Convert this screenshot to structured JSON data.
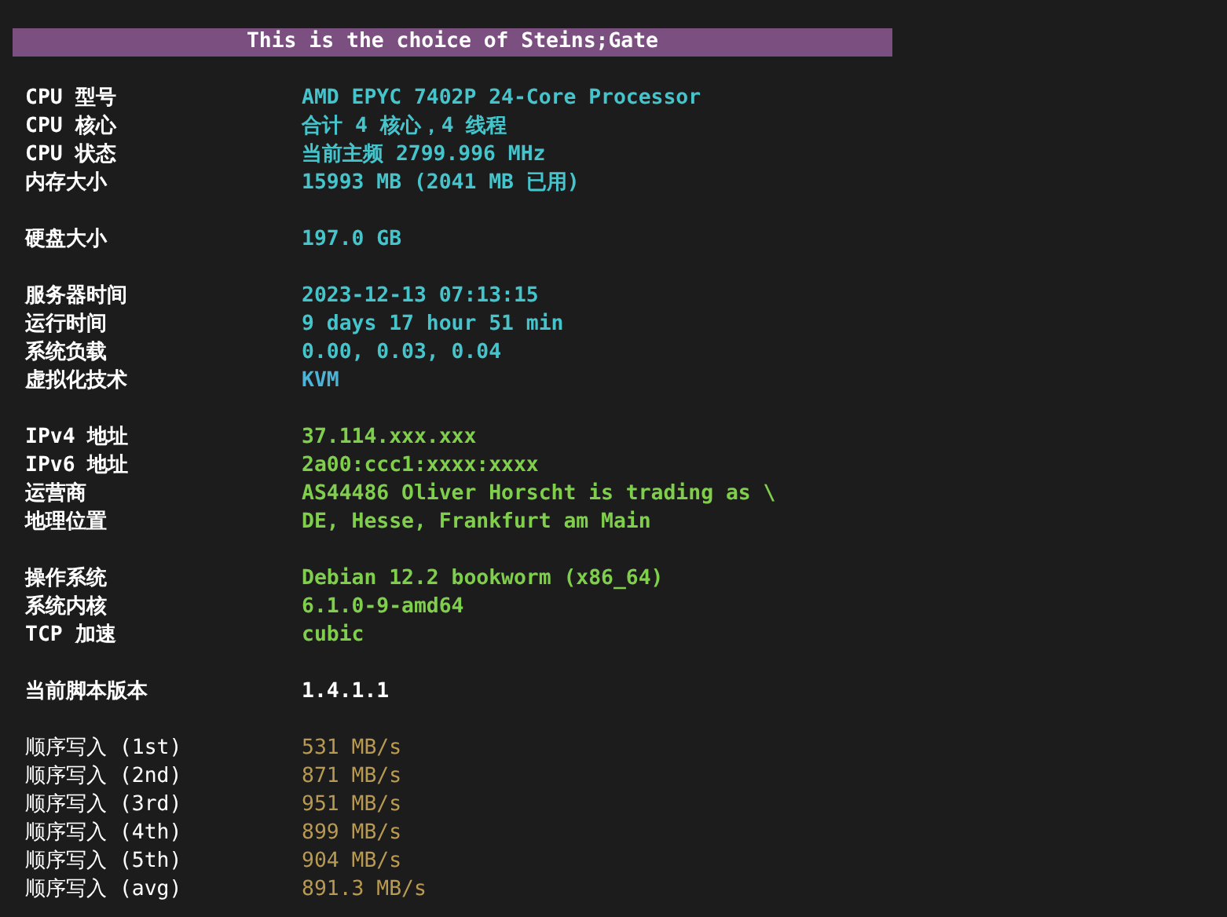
{
  "banner": "This is the choice of Steins;Gate",
  "sections": [
    {
      "kind": "info",
      "rows": [
        {
          "label": "CPU 型号",
          "value": "AMD EPYC 7402P 24-Core Processor",
          "color": "#45c4cc"
        },
        {
          "label": "CPU 核心",
          "value": "合计 4 核心，4 线程",
          "color": "#45c4cc"
        },
        {
          "label": "CPU 状态",
          "value": "当前主频 2799.996 MHz",
          "color": "#45c4cc"
        },
        {
          "label": "内存大小",
          "value": "15993 MB (2041 MB 已用)",
          "color": "#45c4cc"
        }
      ]
    },
    {
      "kind": "info",
      "rows": [
        {
          "label": "硬盘大小",
          "value": "197.0 GB",
          "color": "#45c4cc"
        }
      ]
    },
    {
      "kind": "info",
      "rows": [
        {
          "label": "服务器时间",
          "value": "2023-12-13 07:13:15",
          "color": "#45c4cc"
        },
        {
          "label": "运行时间",
          "value": "9 days 17 hour 51 min",
          "color": "#45c4cc"
        },
        {
          "label": "系统负载",
          "value": "0.00, 0.03, 0.04",
          "color": "#45c4cc"
        },
        {
          "label": "虚拟化技术",
          "value": "KVM",
          "color": "#4cb4d8"
        }
      ]
    },
    {
      "kind": "info",
      "rows": [
        {
          "label": "IPv4 地址",
          "value": "37.114.xxx.xxx",
          "color": "#80cf4c"
        },
        {
          "label": "IPv6 地址",
          "value": "2a00:ccc1:xxxx:xxxx",
          "color": "#80cf4c"
        },
        {
          "label": "运营商",
          "value": "AS44486 Oliver Horscht is trading as \\",
          "color": "#80cf4c"
        },
        {
          "label": "地理位置",
          "value": "DE, Hesse, Frankfurt am Main",
          "color": "#80cf4c"
        }
      ]
    },
    {
      "kind": "info",
      "rows": [
        {
          "label": "操作系统",
          "value": "Debian 12.2 bookworm (x86_64)",
          "color": "#80cf4c"
        },
        {
          "label": "系统内核",
          "value": "6.1.0-9-amd64",
          "color": "#80cf4c"
        },
        {
          "label": "TCP 加速",
          "value": "cubic",
          "color": "#80cf4c"
        }
      ]
    },
    {
      "kind": "info",
      "rows": [
        {
          "label": "当前脚本版本",
          "value": "1.4.1.1",
          "color": "#ffffff"
        }
      ]
    },
    {
      "kind": "benchmark",
      "rows": [
        {
          "label": "顺序写入 (1st)",
          "value": "531 MB/s",
          "color": "#b99a52"
        },
        {
          "label": "顺序写入 (2nd)",
          "value": "871 MB/s",
          "color": "#b99a52"
        },
        {
          "label": "顺序写入 (3rd)",
          "value": "951 MB/s",
          "color": "#b99a52"
        },
        {
          "label": "顺序写入 (4th)",
          "value": "899 MB/s",
          "color": "#b99a52"
        },
        {
          "label": "顺序写入 (5th)",
          "value": "904 MB/s",
          "color": "#b99a52"
        },
        {
          "label": "顺序写入 (avg)",
          "value": "891.3 MB/s",
          "color": "#b99a52"
        }
      ]
    }
  ]
}
